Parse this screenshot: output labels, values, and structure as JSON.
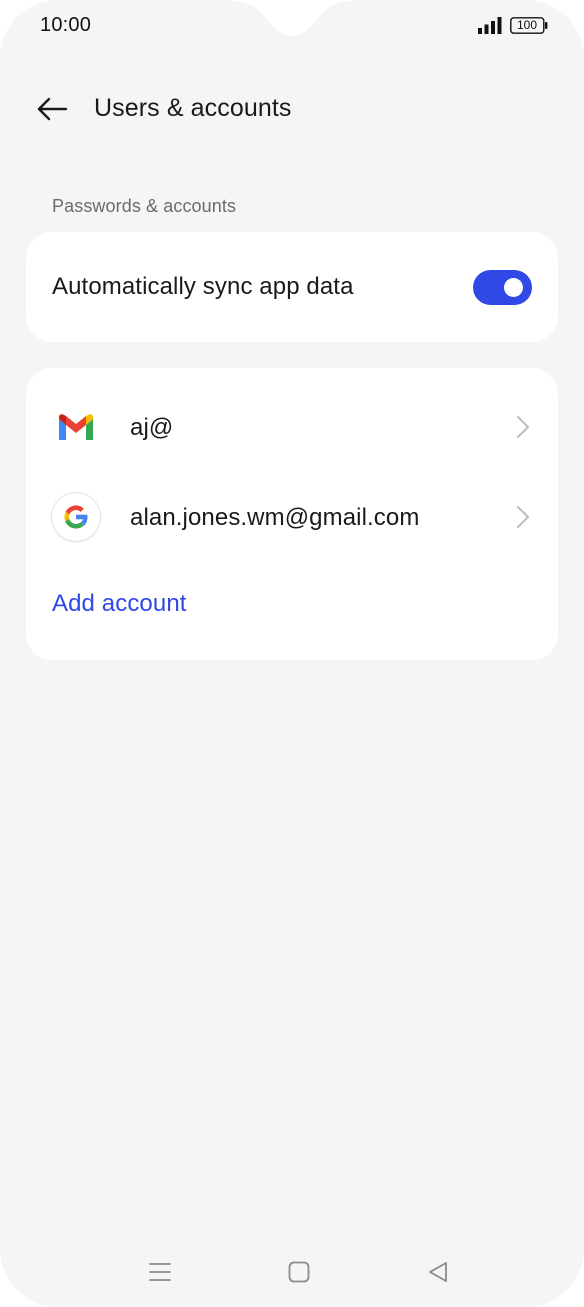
{
  "status_bar": {
    "time": "10:00",
    "battery": "100",
    "icons": [
      "signal-icon",
      "battery-icon"
    ]
  },
  "header": {
    "title": "Users & accounts",
    "back_icon": "arrow-left-icon"
  },
  "section": {
    "label": "Passwords & accounts"
  },
  "sync": {
    "label": "Automatically sync app data",
    "enabled": true
  },
  "accounts": [
    {
      "label": "aj@",
      "icon": "gmail-icon"
    },
    {
      "label": "alan.jones.wm@gmail.com",
      "icon": "google-icon"
    }
  ],
  "add_account_label": "Add account",
  "colors": {
    "accent": "#2f48e6",
    "background": "#f5f5f5",
    "card": "#ffffff",
    "text_primary": "#1a1a1a",
    "text_secondary": "#6b6b6b"
  },
  "nav_bar": {
    "icons": [
      "menu-icon",
      "home-icon",
      "back-triangle-icon"
    ]
  }
}
